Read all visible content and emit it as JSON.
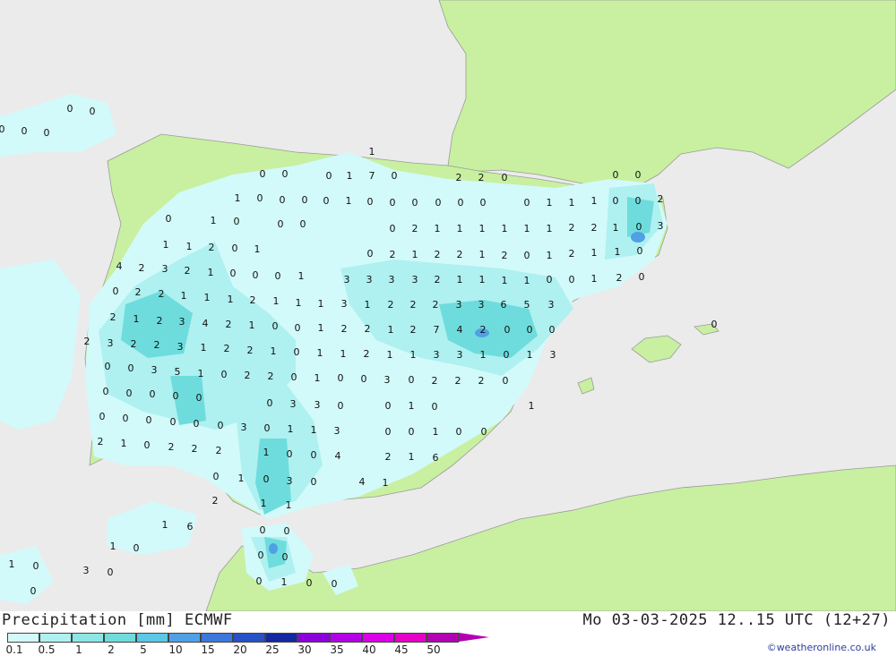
{
  "title": "Precipitation [mm] ECMWF",
  "datetime": "Mo 03-03-2025 12..15 UTC (12+27)",
  "copyright": "©weatheronline.co.uk",
  "legend": {
    "labels": [
      "0.1",
      "0.5",
      "1",
      "2",
      "5",
      "10",
      "15",
      "20",
      "25",
      "30",
      "35",
      "40",
      "45",
      "50"
    ],
    "colors": [
      "#d2fafa",
      "#aff0f0",
      "#8ce6e6",
      "#6edcdc",
      "#5ac8e6",
      "#50a0e6",
      "#3c78dc",
      "#2850c8",
      "#1428a0",
      "#8c00dc",
      "#b400e6",
      "#dc00e6",
      "#e600c8",
      "#b400b4"
    ]
  },
  "map_colors": {
    "sea": "#ebebeb",
    "land": "#c8f0a0",
    "precip_light": "#d2fafa",
    "precip_mid": "#aff0f0",
    "precip_heavy": "#6edcdc",
    "precip_max": "#50a0e6"
  },
  "values": [
    "0",
    "0",
    "0",
    "0",
    "0",
    "1",
    "0",
    "0",
    "0",
    "1",
    "7",
    "0",
    "2",
    "2",
    "0",
    "0",
    "0",
    "1",
    "0",
    "0",
    "0",
    "0",
    "1",
    "0",
    "0",
    "0",
    "0",
    "0",
    "0",
    "0",
    "1",
    "1",
    "1",
    "0",
    "0",
    "2",
    "0",
    "1",
    "0",
    "0",
    "0",
    "0",
    "2",
    "1",
    "1",
    "1",
    "1",
    "1",
    "1",
    "2",
    "2",
    "1",
    "0",
    "3",
    "1",
    "1",
    "2",
    "0",
    "1",
    "0",
    "2",
    "1",
    "2",
    "2",
    "1",
    "2",
    "0",
    "1",
    "2",
    "1",
    "1",
    "0",
    "4",
    "2",
    "3",
    "2",
    "1",
    "0",
    "0",
    "0",
    "1",
    "3",
    "3",
    "3",
    "3",
    "2",
    "1",
    "1",
    "1",
    "1",
    "0",
    "0",
    "1",
    "2",
    "0",
    "0",
    "2",
    "2",
    "1",
    "1",
    "1",
    "2",
    "1",
    "1",
    "1",
    "3",
    "1",
    "2",
    "2",
    "2",
    "3",
    "3",
    "6",
    "5",
    "3",
    "2",
    "1",
    "2",
    "3",
    "4",
    "2",
    "1",
    "0",
    "0",
    "1",
    "2",
    "2",
    "1",
    "2",
    "7",
    "4",
    "2",
    "0",
    "0",
    "0",
    "2",
    "3",
    "2",
    "2",
    "3",
    "1",
    "2",
    "2",
    "1",
    "0",
    "1",
    "1",
    "2",
    "1",
    "1",
    "3",
    "3",
    "1",
    "0",
    "1",
    "3",
    "0",
    "0",
    "3",
    "5",
    "1",
    "0",
    "2",
    "2",
    "0",
    "1",
    "0",
    "0",
    "3",
    "0",
    "2",
    "2",
    "2",
    "0",
    "0",
    "0",
    "0",
    "0",
    "0",
    "0",
    "3",
    "3",
    "0",
    "0",
    "1",
    "0",
    "1",
    "0",
    "0",
    "0",
    "0",
    "0",
    "0",
    "3",
    "0",
    "1",
    "1",
    "3",
    "0",
    "0",
    "1",
    "0",
    "0",
    "2",
    "1",
    "0",
    "2",
    "2",
    "2",
    "1",
    "0",
    "0",
    "4",
    "2",
    "1",
    "6",
    "0",
    "1",
    "0",
    "3",
    "0",
    "4",
    "1",
    "2",
    "1",
    "1",
    "1",
    "6",
    "1",
    "0",
    "0",
    "0",
    "0",
    "0",
    "1",
    "0",
    "3",
    "0",
    "0",
    "1",
    "0",
    "0",
    "0",
    "0"
  ]
}
